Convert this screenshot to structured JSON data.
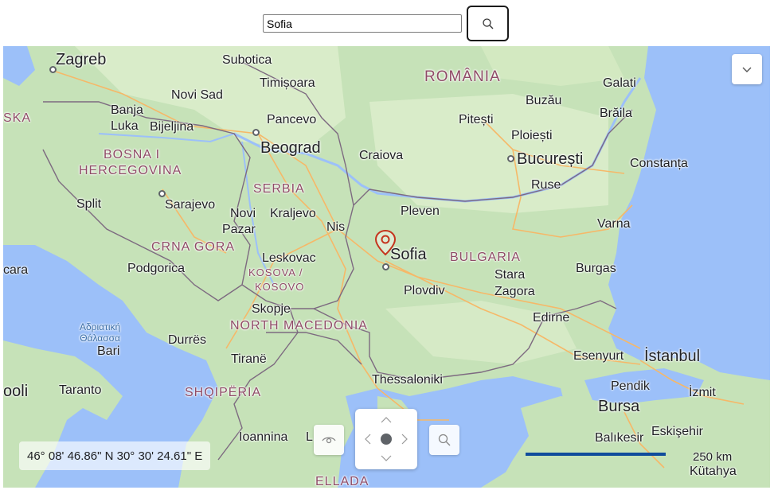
{
  "search": {
    "value": "Sofia"
  },
  "icons": {
    "search": "search-icon",
    "collapse": "chevron-down-icon",
    "eye": "eye-icon",
    "zoom": "search-icon",
    "pin": "location-pin-icon"
  },
  "colors": {
    "land": "#c6e2b8",
    "sea": "#9cc0f9",
    "pin": "#c5341d",
    "scale_bar": "#0f4c9c",
    "country_label": "#8f4b66"
  },
  "map": {
    "labels": {
      "zagreb": "Zagreb",
      "subotica": "Subotica",
      "timisoara": "Timișoara",
      "romania": "ROMÂNIA",
      "galati": "Galati",
      "novi_sad": "Novi Sad",
      "buzau": "Buzău",
      "braila": "Brăila",
      "ska": "SKA",
      "banja_luka_1": "Banja",
      "banja_luka_2": "Luka",
      "bijeljina": "Bijeljina",
      "pancevo": "Pancevo",
      "pitesti": "Pitești",
      "ploiesti": "Ploiești",
      "bosna_1": "BOSNA I",
      "bosna_2": "HERCEGOVINA",
      "beograd": "Beograd",
      "craiova": "Craiova",
      "bucuresti": "București",
      "constanta": "Constanța",
      "serbia": "SERBIA",
      "ruse": "Ruse",
      "split": "Split",
      "sarajevo": "Sarajevo",
      "novi_pazar_1": "Novi",
      "novi_pazar_2": "Pazar",
      "kraljevo": "Kraljevo",
      "pleven": "Pleven",
      "nis": "Nis",
      "varna": "Varna",
      "crna_gora": "CRNA GORA",
      "leskovac": "Leskovac",
      "sofia": "Sofia",
      "bulgaria": "BULGARIA",
      "cara": "cara",
      "podgorica": "Podgorica",
      "kosova_1": "KOSOVA /",
      "kosova_2": "KOSOVO",
      "stara_zagora_1": "Stara",
      "stara_zagora_2": "Zagora",
      "burgas": "Burgas",
      "plovdiv": "Plovdiv",
      "skopje": "Skopje",
      "adriatic": "Αδριατική\nΘάλασσα",
      "north_macedonia": "NORTH MACEDONIA",
      "edirne": "Edirne",
      "bari": "Bari",
      "durres": "Durrës",
      "tirane": "Tiranë",
      "esenyurt": "Esenyurt",
      "istanbul": "İstanbul",
      "thessaloniki": "Thessaloniki",
      "pendik": "Pendik",
      "izmit": "İzmit",
      "bursa": "Bursa",
      "ooli": "ooli",
      "taranto": "Taranto",
      "shqiperia": "SHQIPËRIA",
      "ioannina": "Ioannina",
      "balikesir": "Balıkesir",
      "eskisehir": "Eskişehir",
      "kutahya": "Kütahya",
      "ellada": "ELLADA",
      "sofia_country_edge": "L"
    }
  },
  "status": {
    "coordinates": "46° 08' 46.86\" N 30° 30' 24.61\" E",
    "scale": "250 km"
  }
}
